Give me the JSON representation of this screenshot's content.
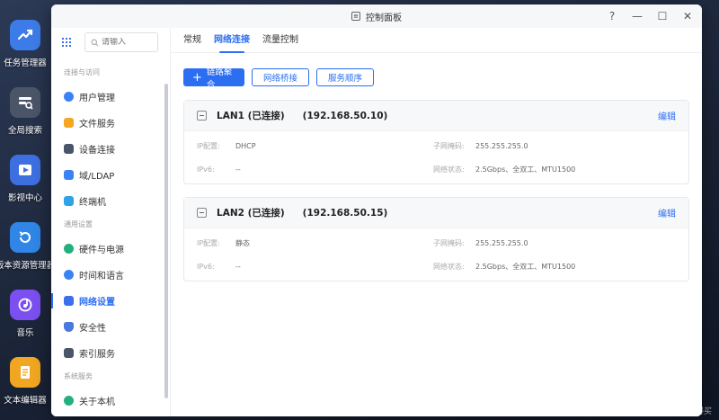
{
  "desktop": {
    "icons": [
      {
        "label": "任务管理器",
        "color": "#3d7be8",
        "icon": "chart-trend-icon"
      },
      {
        "label": "全局搜索",
        "color": "#4b5568",
        "icon": "search-icon"
      },
      {
        "label": "影视中心",
        "color": "#3e6fe0",
        "icon": "play-icon"
      },
      {
        "label": "版本资源管理器",
        "color": "#2f86e6",
        "icon": "history-icon"
      },
      {
        "label": "音乐",
        "color": "#7b4ff0",
        "icon": "music-icon"
      },
      {
        "label": "文本编辑器",
        "color": "#f0a620",
        "icon": "document-icon"
      }
    ]
  },
  "window": {
    "title": "控制面板",
    "controls": {
      "help": "?",
      "minimize": "—",
      "maximize": "☐",
      "close": "✕"
    }
  },
  "sidebar": {
    "search_placeholder": "请输入",
    "sections": [
      {
        "title": "连接与访问",
        "items": [
          {
            "label": "用户管理",
            "icon": "user-icon",
            "color": "#3b82f6"
          },
          {
            "label": "文件服务",
            "icon": "folder-icon",
            "color": "#f5a623"
          },
          {
            "label": "设备连接",
            "icon": "device-icon",
            "color": "#4b5568"
          },
          {
            "label": "域/LDAP",
            "icon": "domain-icon",
            "color": "#3b82f6"
          },
          {
            "label": "终端机",
            "icon": "terminal-icon",
            "color": "#2fa3e8"
          }
        ]
      },
      {
        "title": "通用设置",
        "items": [
          {
            "label": "硬件与电源",
            "icon": "hardware-icon",
            "color": "#22b07d"
          },
          {
            "label": "时间和语言",
            "icon": "clock-icon",
            "color": "#3b82f6"
          },
          {
            "label": "网络设置",
            "icon": "network-icon",
            "color": "#3b6ff0",
            "active": true
          },
          {
            "label": "安全性",
            "icon": "shield-icon",
            "color": "#4a78e0"
          },
          {
            "label": "索引服务",
            "icon": "index-icon",
            "color": "#4b5568"
          }
        ]
      },
      {
        "title": "系统服务",
        "items": [
          {
            "label": "关于本机",
            "icon": "info-icon",
            "color": "#22b07d"
          }
        ]
      }
    ]
  },
  "tabs": [
    {
      "label": "常规",
      "active": false
    },
    {
      "label": "网络连接",
      "active": true
    },
    {
      "label": "流量控制",
      "active": false
    }
  ],
  "toolbar": {
    "aggregate_label": "链路聚合",
    "bridge_label": "网络桥接",
    "order_label": "服务顺序"
  },
  "interfaces": [
    {
      "name": "LAN1 (已连接)",
      "ip": "(192.168.50.10)",
      "edit": "编辑",
      "ip_config_key": "IP配置:",
      "ip_config": "DHCP",
      "subnet_key": "子网掩码:",
      "subnet": "255.255.255.0",
      "ipv6_key": "IPv6:",
      "ipv6": "--",
      "status_key": "网络状态:",
      "status": "2.5Gbps、全双工、MTU1500"
    },
    {
      "name": "LAN2 (已连接)",
      "ip": "(192.168.50.15)",
      "edit": "编辑",
      "ip_config_key": "IP配置:",
      "ip_config": "静态",
      "subnet_key": "子网掩码:",
      "subnet": "255.255.255.0",
      "ipv6_key": "IPv6:",
      "ipv6": "--",
      "status_key": "网络状态:",
      "status": "2.5Gbps、全双工、MTU1500"
    }
  ],
  "watermark": "什么值得买"
}
